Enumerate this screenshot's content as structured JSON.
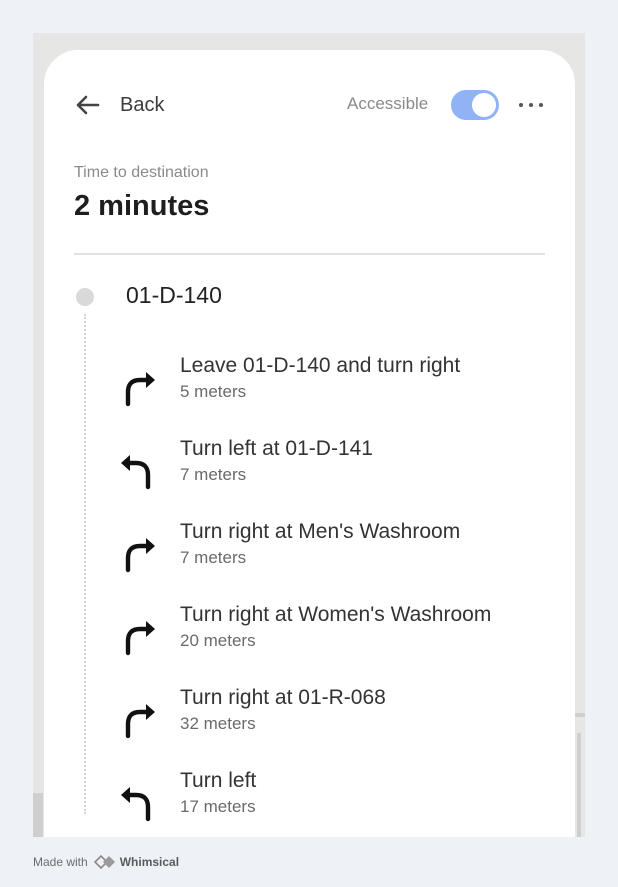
{
  "header": {
    "back_label": "Back",
    "accessible_label": "Accessible",
    "accessible_on": true
  },
  "summary": {
    "time_label": "Time to destination",
    "time_value": "2 minutes"
  },
  "route": {
    "origin": "01-D-140",
    "steps": [
      {
        "icon": "turn-right-icon",
        "title": "Leave 01-D-140 and turn right",
        "distance": "5 meters"
      },
      {
        "icon": "turn-left-icon",
        "title": "Turn left at 01-D-141",
        "distance": "7 meters"
      },
      {
        "icon": "turn-right-icon",
        "title": "Turn right at Men's Washroom",
        "distance": "7 meters"
      },
      {
        "icon": "turn-right-icon",
        "title": "Turn right at Women's Washroom",
        "distance": "20 meters"
      },
      {
        "icon": "turn-right-icon",
        "title": "Turn right at 01-R-068",
        "distance": "32 meters"
      },
      {
        "icon": "turn-left-icon",
        "title": "Turn left",
        "distance": "17 meters"
      }
    ]
  },
  "footer": {
    "made_with": "Made with",
    "brand": "Whimsical"
  },
  "colors": {
    "accent": "#8fb3f5",
    "background": "#eef2f6"
  }
}
